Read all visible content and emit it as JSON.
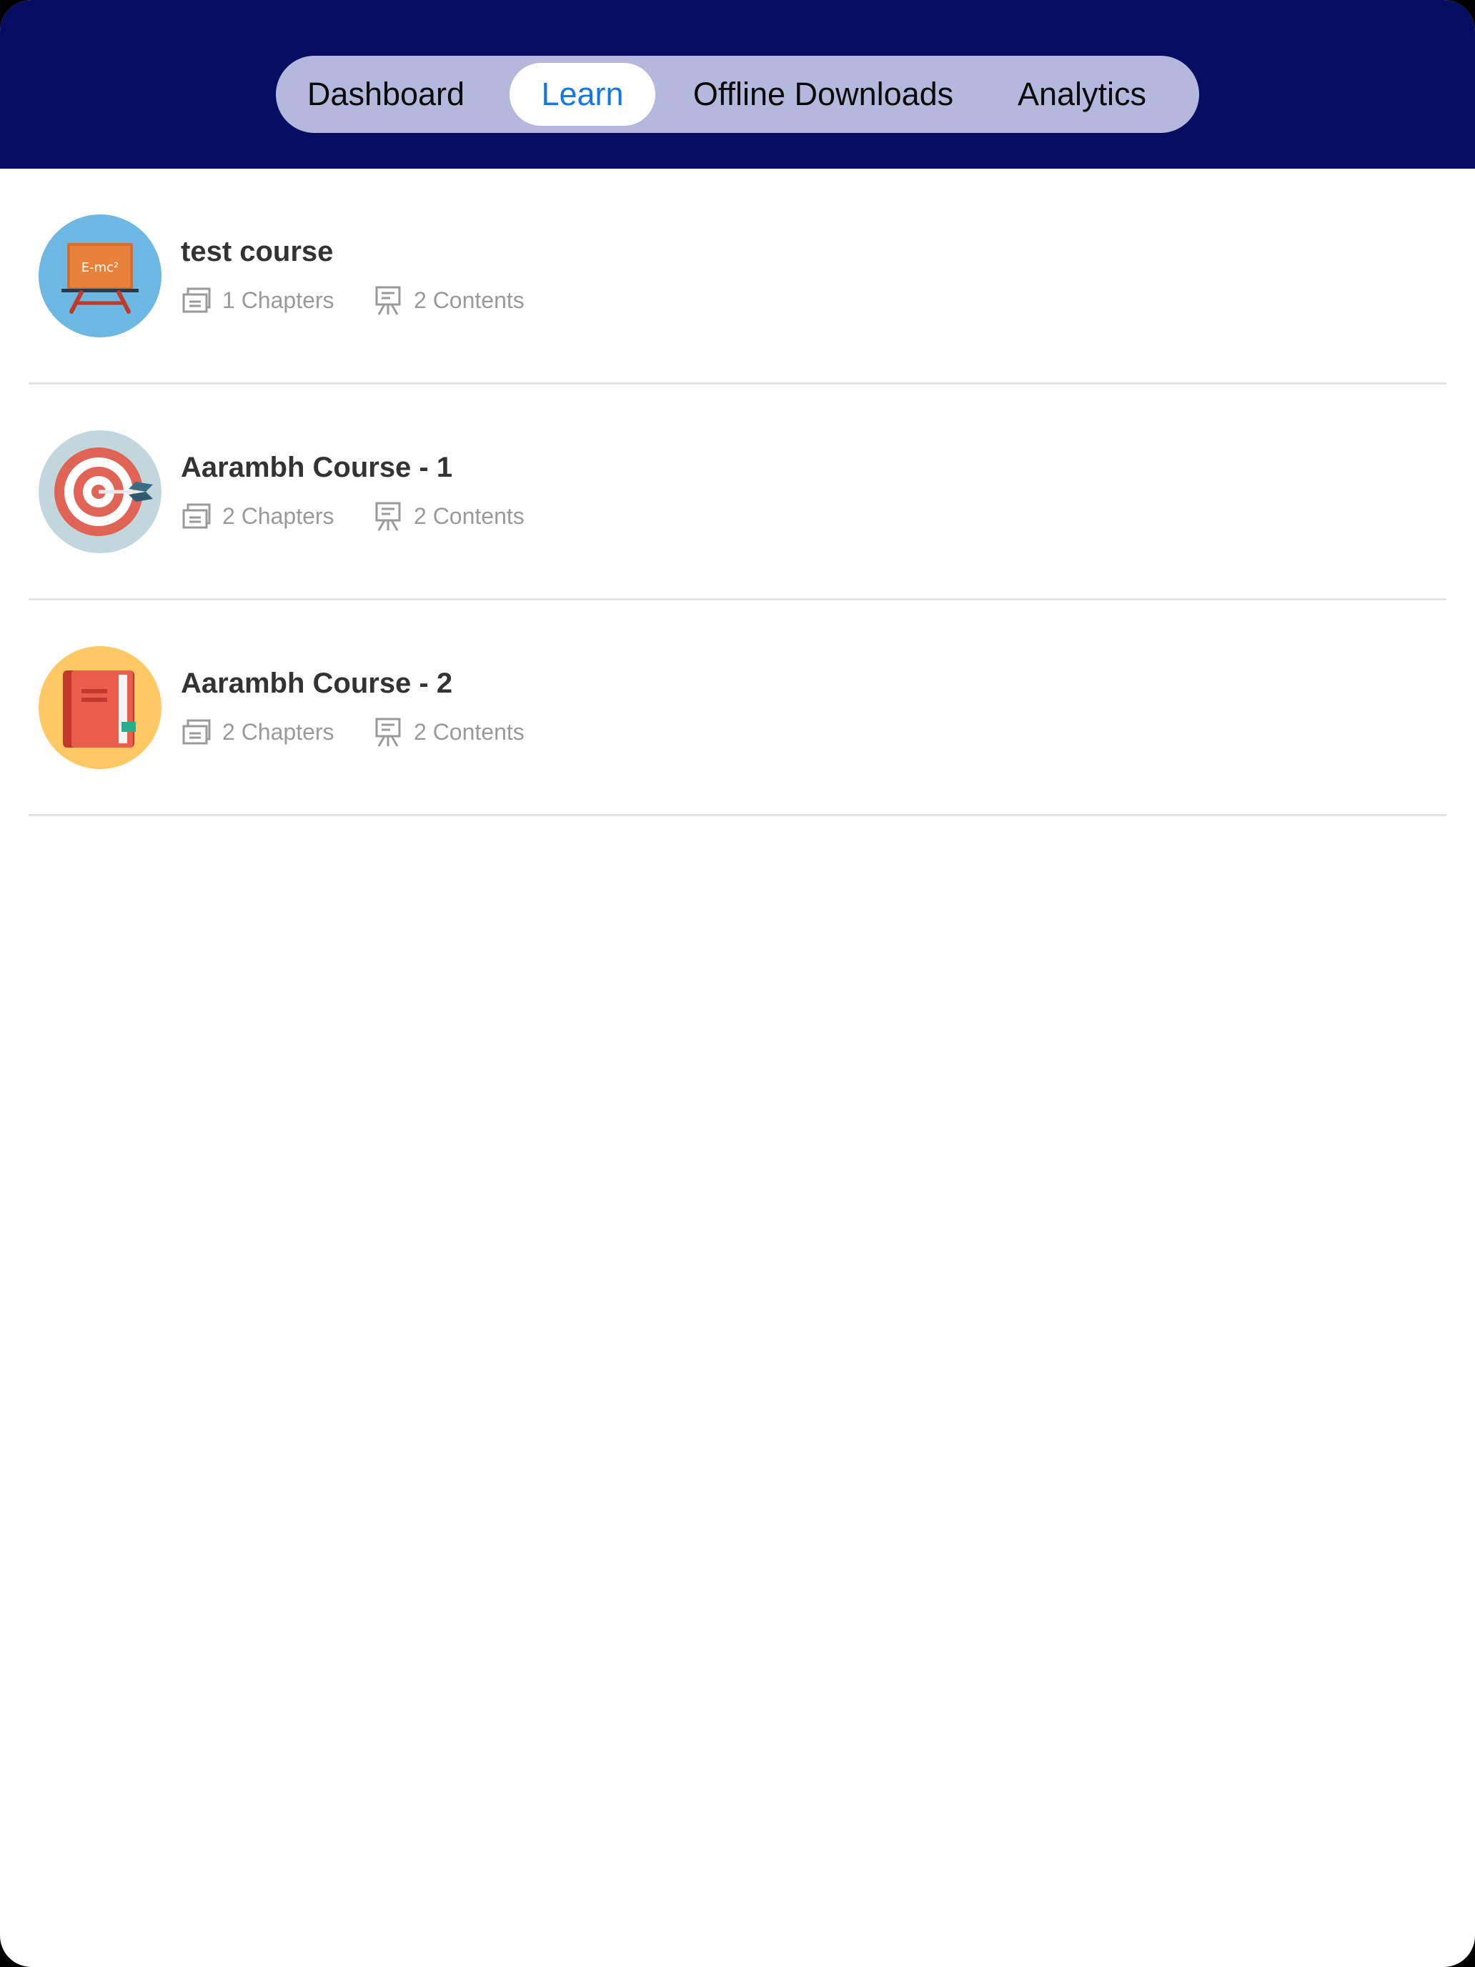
{
  "tabs": [
    {
      "label": "Dashboard",
      "active": false
    },
    {
      "label": "Learn",
      "active": true
    },
    {
      "label": "Offline Downloads",
      "active": false
    },
    {
      "label": "Analytics",
      "active": false
    }
  ],
  "courses": [
    {
      "title": "test course",
      "chapters": "1 Chapters",
      "contents": "2 Contents",
      "thumbnail": {
        "icon": "blackboard-icon",
        "text": "E-mc²",
        "bg": "#6cb8e2"
      }
    },
    {
      "title": "Aarambh Course - 1",
      "chapters": "2 Chapters",
      "contents": "2 Contents",
      "thumbnail": {
        "icon": "target-icon",
        "bg": "#c2d7dc"
      }
    },
    {
      "title": "Aarambh Course - 2",
      "chapters": "2 Chapters",
      "contents": "2 Contents",
      "thumbnail": {
        "icon": "book-icon",
        "bg": "#fec865"
      }
    }
  ],
  "colors": {
    "header_bg": "#070e62",
    "segment_bg": "#b5b8dd",
    "active_tab_text": "#1577e5",
    "title_text": "#333333",
    "meta_text": "#9a9a9a",
    "divider": "#e3e3e3"
  },
  "meta_icons": {
    "chapters": "document-stack-icon",
    "contents": "presentation-board-icon"
  }
}
